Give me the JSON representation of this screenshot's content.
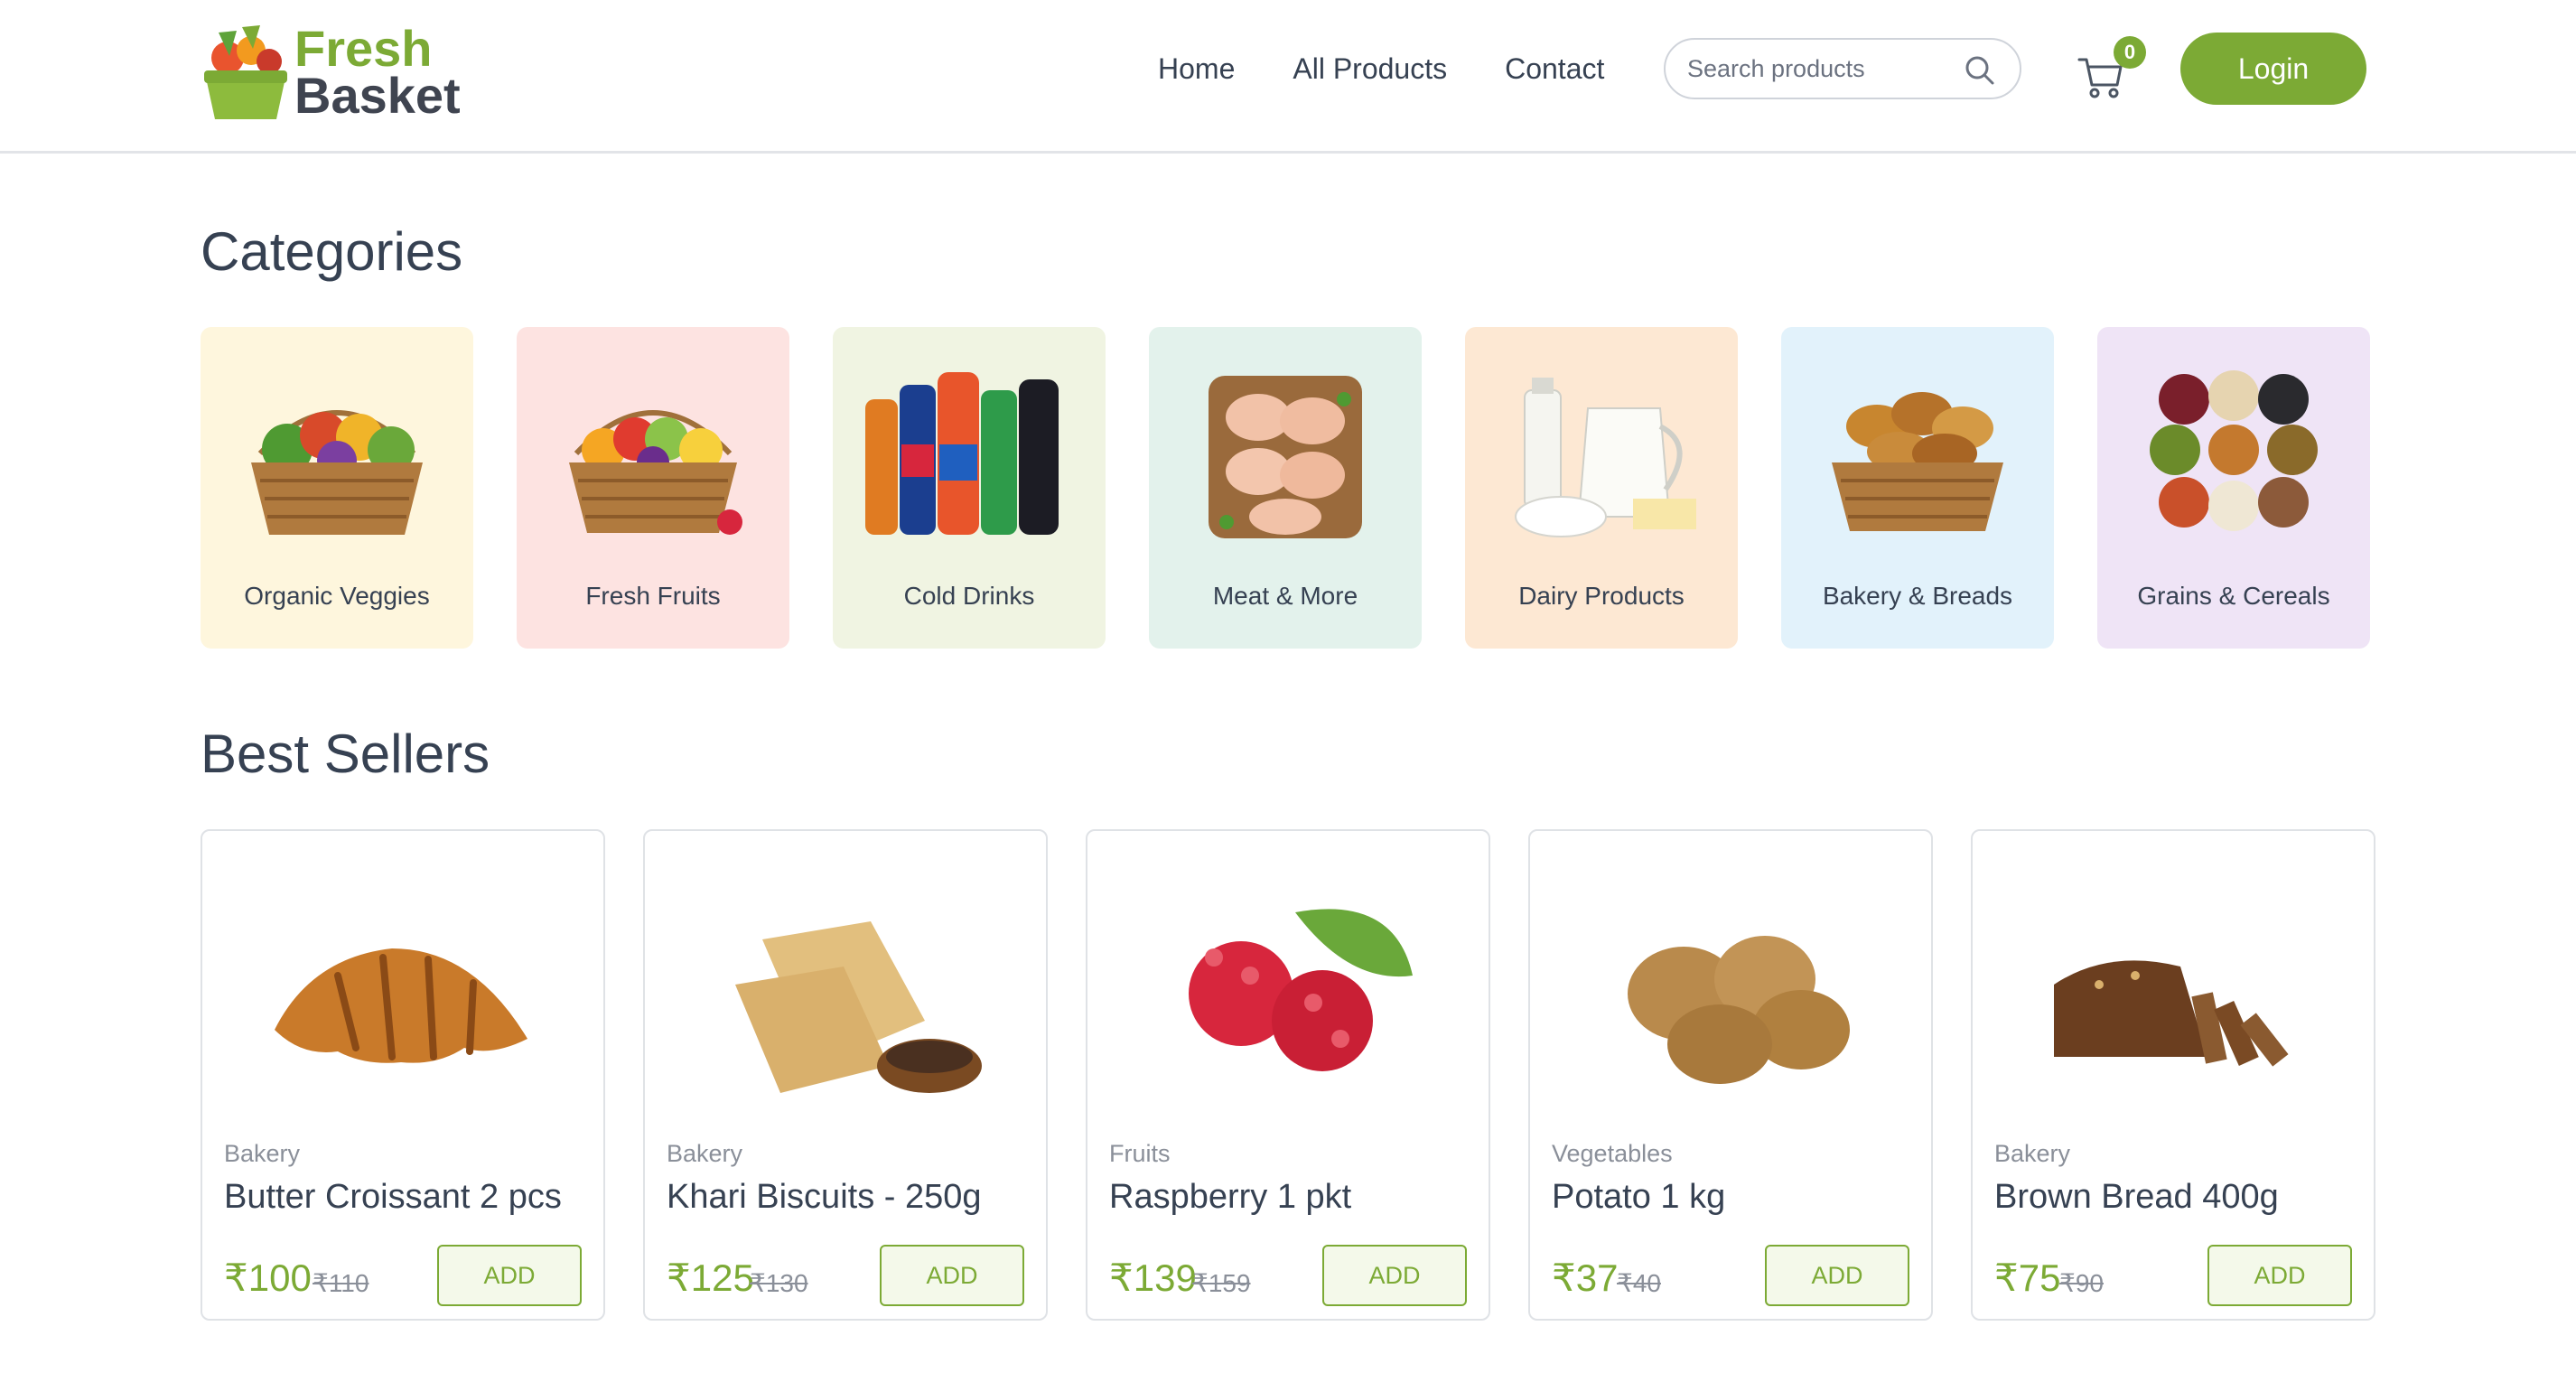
{
  "brand": {
    "line1": "Fresh",
    "line2": "Basket",
    "green": "#7caa35",
    "dark": "#3f4450"
  },
  "nav": {
    "items": [
      "Home",
      "All Products",
      "Contact"
    ]
  },
  "search": {
    "placeholder": "Search products",
    "value": ""
  },
  "cart": {
    "count": "0"
  },
  "auth": {
    "login_label": "Login"
  },
  "sections": {
    "categories_title": "Categories",
    "best_sellers_title": "Best Sellers"
  },
  "categories": [
    {
      "label": "Organic Veggies",
      "bg": "#fef6dd",
      "icon": "veggie-basket"
    },
    {
      "label": "Fresh Fruits",
      "bg": "#fde3e1",
      "icon": "fruit-basket"
    },
    {
      "label": "Cold Drinks",
      "bg": "#f0f4e2",
      "icon": "soda-bottles"
    },
    {
      "label": "Meat & More",
      "bg": "#e3f2ec",
      "icon": "raw-chicken"
    },
    {
      "label": "Dairy Products",
      "bg": "#fde8d3",
      "icon": "milk-jug"
    },
    {
      "label": "Bakery & Breads",
      "bg": "#e2f2fb",
      "icon": "bread-basket"
    },
    {
      "label": "Grains & Cereals",
      "bg": "#efe4f6",
      "icon": "grain-pile"
    }
  ],
  "products": [
    {
      "category": "Bakery",
      "name": "Butter Croissant 2 pcs",
      "price": "₹100",
      "mrp": "₹110",
      "add_label": "ADD",
      "icon": "croissant"
    },
    {
      "category": "Bakery",
      "name": "Khari Biscuits - 250g",
      "price": "₹125",
      "mrp": "₹130",
      "add_label": "ADD",
      "icon": "khari-biscuits"
    },
    {
      "category": "Fruits",
      "name": "Raspberry 1 pkt",
      "price": "₹139",
      "mrp": "₹159",
      "add_label": "ADD",
      "icon": "raspberry"
    },
    {
      "category": "Vegetables",
      "name": "Potato 1 kg",
      "price": "₹37",
      "mrp": "₹40",
      "add_label": "ADD",
      "icon": "potato"
    },
    {
      "category": "Bakery",
      "name": "Brown Bread 400g",
      "price": "₹75",
      "mrp": "₹90",
      "add_label": "ADD",
      "icon": "brown-bread"
    }
  ]
}
